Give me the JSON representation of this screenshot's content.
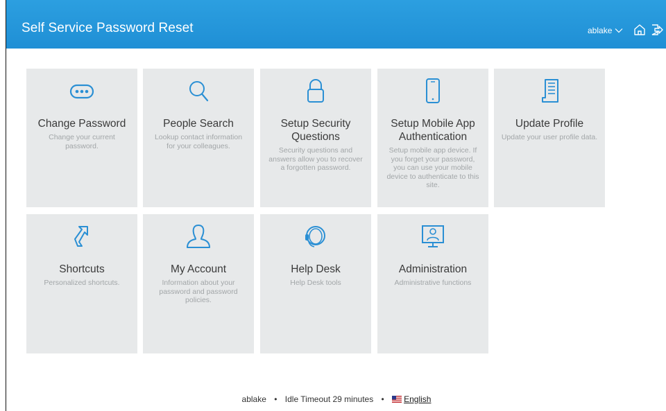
{
  "header": {
    "title": "Self Service Password Reset",
    "username": "ablake",
    "icons": [
      "chevron-down-icon",
      "home-icon",
      "logout-icon"
    ]
  },
  "tiles": [
    {
      "title": "Change Password",
      "description": "Change your current password.",
      "icon": "password-dots-icon"
    },
    {
      "title": "People Search",
      "description": "Lookup contact information for your colleagues.",
      "icon": "search-icon"
    },
    {
      "title": "Setup Security Questions",
      "description": "Security questions and answers allow you to recover a forgotten password.",
      "icon": "lock-icon"
    },
    {
      "title": "Setup Mobile App Authentication",
      "description": "Setup mobile app device. If you forget your password, you can use your mobile device to authenticate to this site.",
      "icon": "mobile-phone-icon"
    },
    {
      "title": "Update Profile",
      "description": "Update your user profile data.",
      "icon": "profile-document-icon"
    },
    {
      "title": "Shortcuts",
      "description": "Personalized shortcuts.",
      "icon": "shortcut-arrow-icon"
    },
    {
      "title": "My Account",
      "description": "Information about your password and password policies.",
      "icon": "user-icon"
    },
    {
      "title": "Help Desk",
      "description": "Help Desk tools",
      "icon": "headset-icon"
    },
    {
      "title": "Administration",
      "description": "Administrative functions",
      "icon": "admin-monitor-icon"
    }
  ],
  "footer": {
    "username": "ablake",
    "idle_timeout": "Idle Timeout 29 minutes",
    "language": "English",
    "separator": "•"
  },
  "colors": {
    "header_bg": "#2196db",
    "tile_bg": "#e7e9ea",
    "icon_color": "#2a8fd4"
  }
}
